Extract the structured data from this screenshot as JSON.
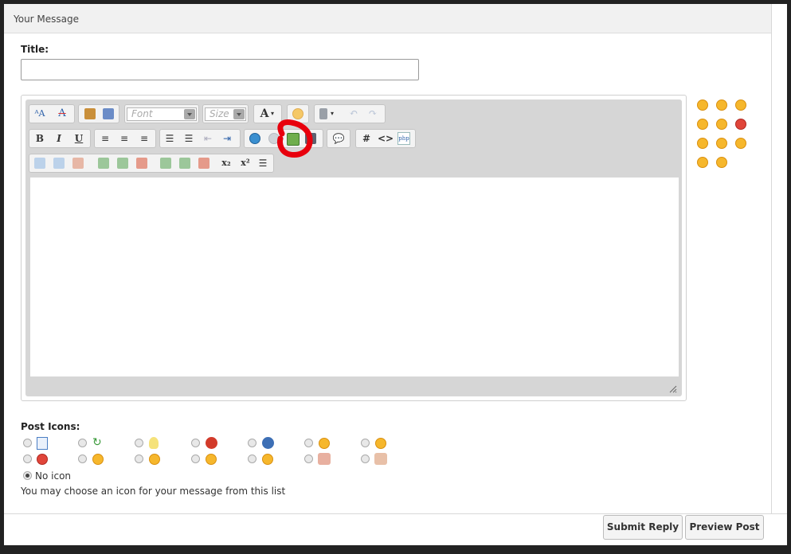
{
  "header": {
    "title": "Your Message"
  },
  "form": {
    "title_label": "Title:",
    "title_value": ""
  },
  "toolbar": {
    "font_label": "Font",
    "size_label": "Size",
    "font_color_label": "A",
    "bold_label": "B",
    "italic_label": "I",
    "underline_label": "U",
    "hash_label": "#",
    "code_label": "<>",
    "php_label": "php",
    "subscript_label": "x₂",
    "superscript_label": "x²"
  },
  "post_icons": {
    "label": "Post Icons:",
    "no_icon_label": "No icon",
    "help_text": "You may choose an icon for your message from this list",
    "selected": "No icon"
  },
  "buttons": {
    "submit": "Submit Reply",
    "preview": "Preview Post"
  },
  "colors": {
    "background_frame": "#222222",
    "panel": "#ffffff",
    "toolbar_bg": "#d6d6d6",
    "annotation": "#e8000d",
    "smiley": "#f6b72c"
  }
}
